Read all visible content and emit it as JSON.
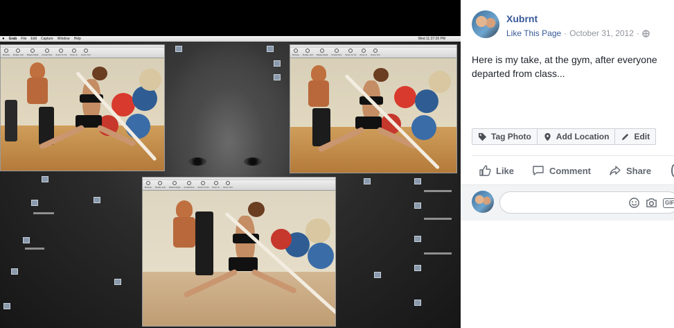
{
  "post": {
    "page_name": "Xubrnt",
    "like_link": "Like This Page",
    "date": "October 31, 2012",
    "separator": "·",
    "privacy_icon": "globe-icon",
    "text": "Here is my take, at the gym, after everyone departed from class..."
  },
  "photo_actions": {
    "tag": "Tag Photo",
    "location": "Add Location",
    "edit": "Edit"
  },
  "reactions": {
    "like": "Like",
    "comment": "Comment",
    "share": "Share"
  },
  "comment": {
    "placeholder": "",
    "icons": [
      "emoji-icon",
      "camera-icon",
      "gif-icon"
    ],
    "gif_label": "GIF"
  },
  "photo": {
    "menubar": {
      "app": "Grab",
      "items": [
        "File",
        "Edit",
        "Capture",
        "Window",
        "Help"
      ],
      "clock": "Wed 11:37:26 PM"
    },
    "toolbar_tools": [
      "Browse",
      "Rotate Left",
      "Rotate Right",
      "Actual Size",
      "Zoom To Fit",
      "Zoom In",
      "Zoom Out"
    ]
  },
  "colors": {
    "fb_blue": "#365899",
    "meta_gray": "#90949c",
    "text": "#1d2129",
    "button_bg": "#f6f7f9"
  }
}
